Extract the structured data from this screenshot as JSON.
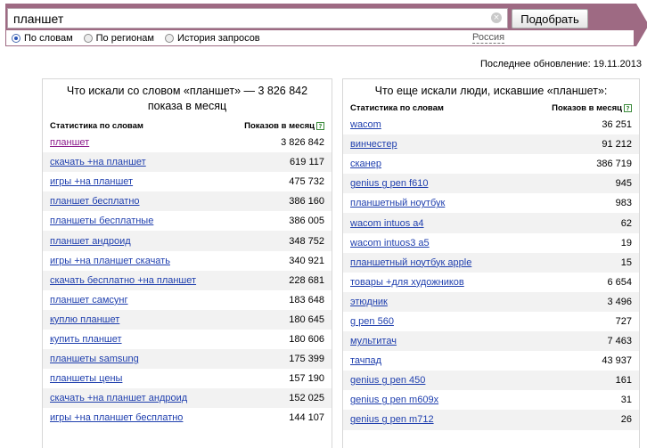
{
  "search": {
    "query": "планшет",
    "submit_label": "Подобрать",
    "clear_glyph": "×"
  },
  "modes": [
    {
      "label": "По словам",
      "checked": true
    },
    {
      "label": "По регионам",
      "checked": false
    },
    {
      "label": "История запросов",
      "checked": false
    }
  ],
  "region": "Россия",
  "updated": "Последнее обновление: 19.11.2013",
  "left_panel": {
    "title": "Что искали со словом «планшет» — 3 826 842 показа в месяц",
    "col_phrase": "Статистика по словам",
    "col_count": "Показов в месяц",
    "help_glyph": "?",
    "rows": [
      {
        "phrase": "планшет",
        "count": "3 826 842"
      },
      {
        "phrase": "скачать +на планшет",
        "count": "619 117"
      },
      {
        "phrase": "игры +на планшет",
        "count": "475 732"
      },
      {
        "phrase": "планшет бесплатно",
        "count": "386 160"
      },
      {
        "phrase": "планшеты бесплатные",
        "count": "386 005"
      },
      {
        "phrase": "планшет андроид",
        "count": "348 752"
      },
      {
        "phrase": "игры +на планшет скачать",
        "count": "340 921"
      },
      {
        "phrase": "скачать бесплатно +на планшет",
        "count": "228 681"
      },
      {
        "phrase": "планшет самсунг",
        "count": "183 648"
      },
      {
        "phrase": "куплю планшет",
        "count": "180 645"
      },
      {
        "phrase": "купить планшет",
        "count": "180 606"
      },
      {
        "phrase": "планшеты samsung",
        "count": "175 399"
      },
      {
        "phrase": "планшеты цены",
        "count": "157 190"
      },
      {
        "phrase": "скачать +на планшет андроид",
        "count": "152 025"
      },
      {
        "phrase": "игры +на планшет бесплатно",
        "count": "144 107"
      }
    ]
  },
  "right_panel": {
    "title": "Что еще искали люди, искавшие «планшет»:",
    "col_phrase": "Статистика по словам",
    "col_count": "Показов в месяц",
    "help_glyph": "?",
    "rows": [
      {
        "phrase": "wacom",
        "count": "36 251"
      },
      {
        "phrase": "винчестер",
        "count": "91 212"
      },
      {
        "phrase": "сканер",
        "count": "386 719"
      },
      {
        "phrase": "genius g pen f610",
        "count": "945"
      },
      {
        "phrase": "планшетный ноутбук",
        "count": "983"
      },
      {
        "phrase": "wacom intuos a4",
        "count": "62"
      },
      {
        "phrase": "wacom intuos3 a5",
        "count": "19"
      },
      {
        "phrase": "планшетный ноутбук apple",
        "count": "15"
      },
      {
        "phrase": "товары +для художников",
        "count": "6 654"
      },
      {
        "phrase": "этюдник",
        "count": "3 496"
      },
      {
        "phrase": "g pen 560",
        "count": "727"
      },
      {
        "phrase": "мультитач",
        "count": "7 463"
      },
      {
        "phrase": "тачпад",
        "count": "43 937"
      },
      {
        "phrase": "genius g pen 450",
        "count": "161"
      },
      {
        "phrase": "genius g pen m609x",
        "count": "31"
      },
      {
        "phrase": "genius g pen m712",
        "count": "26"
      }
    ]
  }
}
